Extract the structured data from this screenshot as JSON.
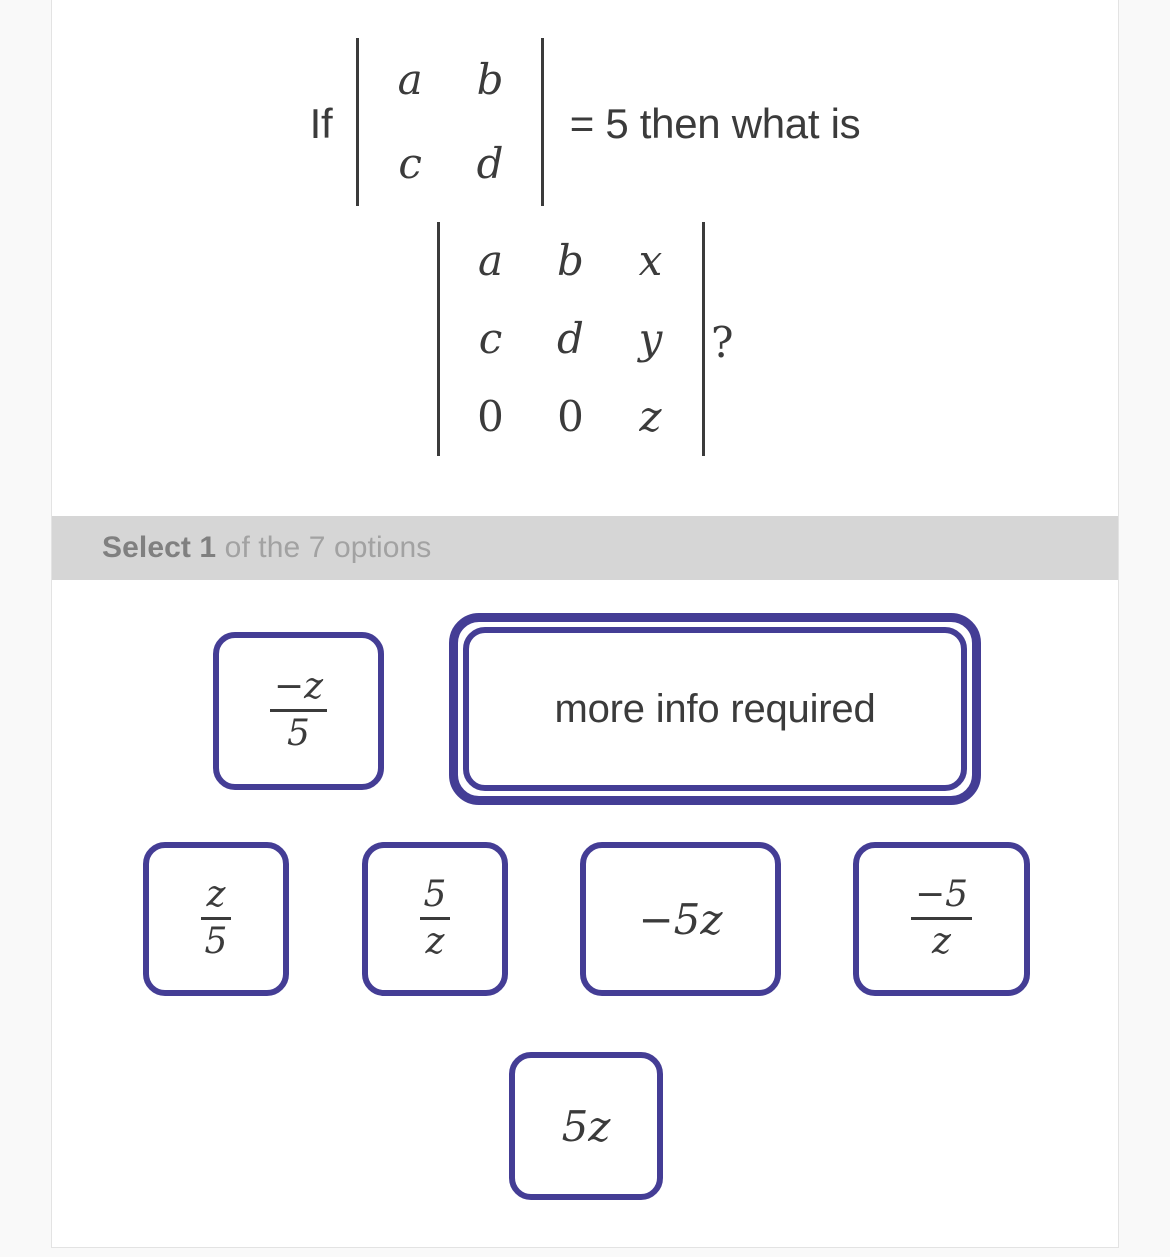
{
  "question": {
    "if_word": "If",
    "det2": {
      "rows": [
        [
          "a",
          "b"
        ],
        [
          "c",
          "d"
        ]
      ]
    },
    "equals_text": "= 5 then what is",
    "det3": {
      "rows": [
        [
          "a",
          "b",
          "x"
        ],
        [
          "c",
          "d",
          "y"
        ],
        [
          "0",
          "0",
          "z"
        ]
      ]
    },
    "question_mark": "?"
  },
  "select_bar": {
    "strong_text": "Select 1",
    "rest_text": " of the 7 options"
  },
  "options": [
    {
      "id": "opt0",
      "kind": "fraction",
      "numerator": "−z",
      "denominator": "5",
      "label": "-z/5",
      "selected": false
    },
    {
      "id": "opt1",
      "kind": "text",
      "label": "more info required",
      "selected": true
    },
    {
      "id": "opt2",
      "kind": "fraction",
      "numerator": "z",
      "denominator": "5",
      "label": "z/5",
      "selected": false
    },
    {
      "id": "opt3",
      "kind": "fraction",
      "numerator": "5",
      "denominator": "z",
      "label": "5/z",
      "selected": false
    },
    {
      "id": "opt4",
      "kind": "math",
      "label": "−5z",
      "selected": false
    },
    {
      "id": "opt5",
      "kind": "fraction",
      "numerator": "−5",
      "denominator": "z",
      "label": "-5/z",
      "selected": false
    },
    {
      "id": "opt6",
      "kind": "math",
      "label": "5z",
      "selected": false
    }
  ],
  "colors": {
    "accent_purple": "#443d95",
    "select_bar_bg": "#d6d6d6",
    "page_bg": "#f9f9f9",
    "text": "#3b3b3b"
  }
}
